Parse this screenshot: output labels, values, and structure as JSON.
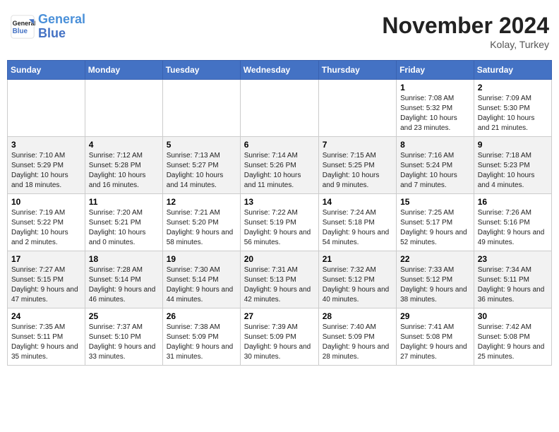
{
  "header": {
    "logo_line1": "General",
    "logo_line2": "Blue",
    "month": "November 2024",
    "location": "Kolay, Turkey"
  },
  "weekdays": [
    "Sunday",
    "Monday",
    "Tuesday",
    "Wednesday",
    "Thursday",
    "Friday",
    "Saturday"
  ],
  "weeks": [
    [
      {
        "day": "",
        "info": ""
      },
      {
        "day": "",
        "info": ""
      },
      {
        "day": "",
        "info": ""
      },
      {
        "day": "",
        "info": ""
      },
      {
        "day": "",
        "info": ""
      },
      {
        "day": "1",
        "info": "Sunrise: 7:08 AM\nSunset: 5:32 PM\nDaylight: 10 hours and 23 minutes."
      },
      {
        "day": "2",
        "info": "Sunrise: 7:09 AM\nSunset: 5:30 PM\nDaylight: 10 hours and 21 minutes."
      }
    ],
    [
      {
        "day": "3",
        "info": "Sunrise: 7:10 AM\nSunset: 5:29 PM\nDaylight: 10 hours and 18 minutes."
      },
      {
        "day": "4",
        "info": "Sunrise: 7:12 AM\nSunset: 5:28 PM\nDaylight: 10 hours and 16 minutes."
      },
      {
        "day": "5",
        "info": "Sunrise: 7:13 AM\nSunset: 5:27 PM\nDaylight: 10 hours and 14 minutes."
      },
      {
        "day": "6",
        "info": "Sunrise: 7:14 AM\nSunset: 5:26 PM\nDaylight: 10 hours and 11 minutes."
      },
      {
        "day": "7",
        "info": "Sunrise: 7:15 AM\nSunset: 5:25 PM\nDaylight: 10 hours and 9 minutes."
      },
      {
        "day": "8",
        "info": "Sunrise: 7:16 AM\nSunset: 5:24 PM\nDaylight: 10 hours and 7 minutes."
      },
      {
        "day": "9",
        "info": "Sunrise: 7:18 AM\nSunset: 5:23 PM\nDaylight: 10 hours and 4 minutes."
      }
    ],
    [
      {
        "day": "10",
        "info": "Sunrise: 7:19 AM\nSunset: 5:22 PM\nDaylight: 10 hours and 2 minutes."
      },
      {
        "day": "11",
        "info": "Sunrise: 7:20 AM\nSunset: 5:21 PM\nDaylight: 10 hours and 0 minutes."
      },
      {
        "day": "12",
        "info": "Sunrise: 7:21 AM\nSunset: 5:20 PM\nDaylight: 9 hours and 58 minutes."
      },
      {
        "day": "13",
        "info": "Sunrise: 7:22 AM\nSunset: 5:19 PM\nDaylight: 9 hours and 56 minutes."
      },
      {
        "day": "14",
        "info": "Sunrise: 7:24 AM\nSunset: 5:18 PM\nDaylight: 9 hours and 54 minutes."
      },
      {
        "day": "15",
        "info": "Sunrise: 7:25 AM\nSunset: 5:17 PM\nDaylight: 9 hours and 52 minutes."
      },
      {
        "day": "16",
        "info": "Sunrise: 7:26 AM\nSunset: 5:16 PM\nDaylight: 9 hours and 49 minutes."
      }
    ],
    [
      {
        "day": "17",
        "info": "Sunrise: 7:27 AM\nSunset: 5:15 PM\nDaylight: 9 hours and 47 minutes."
      },
      {
        "day": "18",
        "info": "Sunrise: 7:28 AM\nSunset: 5:14 PM\nDaylight: 9 hours and 46 minutes."
      },
      {
        "day": "19",
        "info": "Sunrise: 7:30 AM\nSunset: 5:14 PM\nDaylight: 9 hours and 44 minutes."
      },
      {
        "day": "20",
        "info": "Sunrise: 7:31 AM\nSunset: 5:13 PM\nDaylight: 9 hours and 42 minutes."
      },
      {
        "day": "21",
        "info": "Sunrise: 7:32 AM\nSunset: 5:12 PM\nDaylight: 9 hours and 40 minutes."
      },
      {
        "day": "22",
        "info": "Sunrise: 7:33 AM\nSunset: 5:12 PM\nDaylight: 9 hours and 38 minutes."
      },
      {
        "day": "23",
        "info": "Sunrise: 7:34 AM\nSunset: 5:11 PM\nDaylight: 9 hours and 36 minutes."
      }
    ],
    [
      {
        "day": "24",
        "info": "Sunrise: 7:35 AM\nSunset: 5:11 PM\nDaylight: 9 hours and 35 minutes."
      },
      {
        "day": "25",
        "info": "Sunrise: 7:37 AM\nSunset: 5:10 PM\nDaylight: 9 hours and 33 minutes."
      },
      {
        "day": "26",
        "info": "Sunrise: 7:38 AM\nSunset: 5:09 PM\nDaylight: 9 hours and 31 minutes."
      },
      {
        "day": "27",
        "info": "Sunrise: 7:39 AM\nSunset: 5:09 PM\nDaylight: 9 hours and 30 minutes."
      },
      {
        "day": "28",
        "info": "Sunrise: 7:40 AM\nSunset: 5:09 PM\nDaylight: 9 hours and 28 minutes."
      },
      {
        "day": "29",
        "info": "Sunrise: 7:41 AM\nSunset: 5:08 PM\nDaylight: 9 hours and 27 minutes."
      },
      {
        "day": "30",
        "info": "Sunrise: 7:42 AM\nSunset: 5:08 PM\nDaylight: 9 hours and 25 minutes."
      }
    ]
  ]
}
